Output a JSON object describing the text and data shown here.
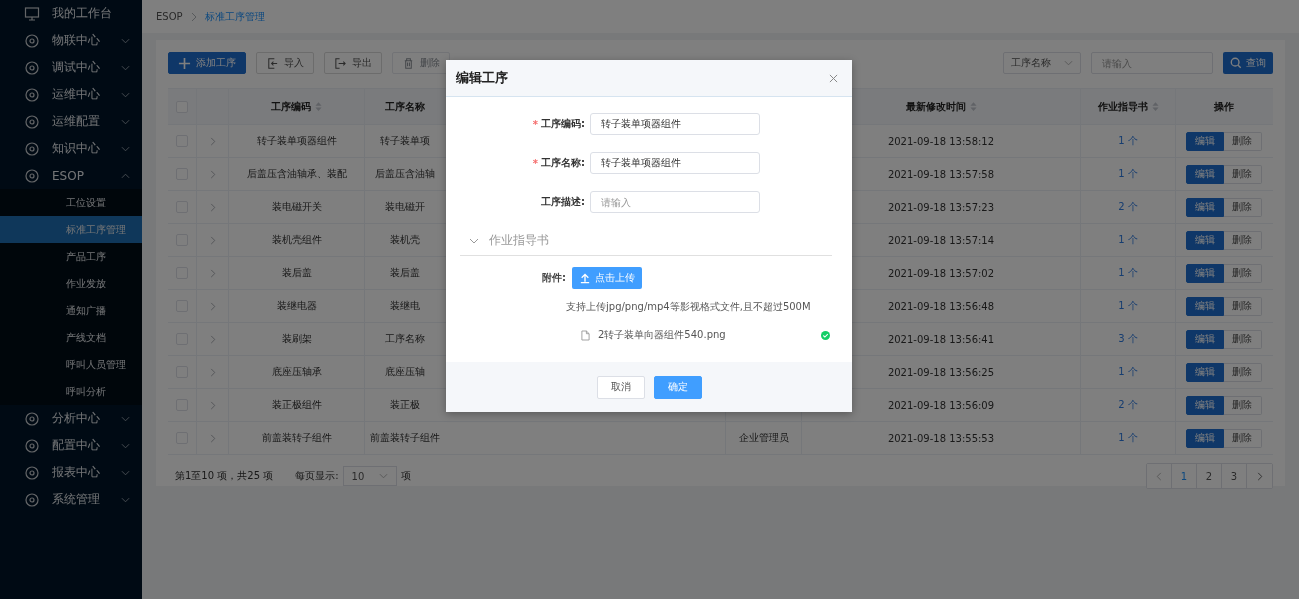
{
  "sidebar": {
    "items": [
      {
        "label": "我的工作台"
      },
      {
        "label": "物联中心",
        "expanded": false
      },
      {
        "label": "调试中心",
        "expanded": false
      },
      {
        "label": "运维中心",
        "expanded": false
      },
      {
        "label": "运维配置",
        "expanded": false
      },
      {
        "label": "知识中心",
        "expanded": false
      },
      {
        "label": "ESOP",
        "expanded": true,
        "children": [
          {
            "label": "工位设置",
            "selected": false
          },
          {
            "label": "标准工序管理",
            "selected": true
          },
          {
            "label": "产品工序",
            "selected": false
          },
          {
            "label": "作业发放",
            "selected": false
          },
          {
            "label": "通知广播",
            "selected": false
          },
          {
            "label": "产线文档",
            "selected": false
          },
          {
            "label": "呼叫人员管理",
            "selected": false
          },
          {
            "label": "呼叫分析",
            "selected": false
          }
        ]
      },
      {
        "label": "分析中心",
        "expanded": false
      },
      {
        "label": "配置中心",
        "expanded": false
      },
      {
        "label": "报表中心",
        "expanded": false
      },
      {
        "label": "系统管理",
        "expanded": false
      }
    ]
  },
  "breadcrumb": [
    "ESOP",
    "标准工序管理"
  ],
  "toolbar": {
    "buttons": [
      {
        "label": "添加工序",
        "kind": "primary",
        "disabled": false
      },
      {
        "label": "导入",
        "kind": "import",
        "disabled": false
      },
      {
        "label": "导出",
        "kind": "export",
        "disabled": false
      },
      {
        "label": "删除",
        "kind": "delete",
        "disabled": true
      }
    ],
    "filter_field": "工序名称",
    "search": {
      "placeholder": "请输入"
    },
    "search_button": "查询"
  },
  "table": {
    "all_checked": false,
    "columns": [
      {
        "label": "工序编码",
        "sortable": true
      },
      {
        "label": "工序名称",
        "sortable": false
      },
      {
        "label": "最新修改时间",
        "sortable": true
      },
      {
        "label": "作业指导书",
        "sortable": true
      },
      {
        "label": "操作",
        "sortable": false
      }
    ],
    "rows": [
      {
        "checked": false,
        "code": "转子装单项器组件",
        "name": "转子装单项",
        "modified": "2021-09-18 13:58:12",
        "guides": "1 个",
        "actions": [
          "编辑",
          "删除"
        ]
      },
      {
        "checked": false,
        "code": "后盖压含油轴承、装配",
        "name": "后盖压含油轴",
        "modified": "2021-09-18 13:57:58",
        "guides": "1 个",
        "actions": [
          "编辑",
          "删除"
        ]
      },
      {
        "checked": false,
        "code": "装电磁开关",
        "name": "装电磁开",
        "modified": "2021-09-18 13:57:23",
        "guides": "2 个",
        "actions": [
          "编辑",
          "删除"
        ]
      },
      {
        "checked": false,
        "code": "装机壳组件",
        "name": "装机壳",
        "modified": "2021-09-18 13:57:14",
        "guides": "1 个",
        "actions": [
          "编辑",
          "删除"
        ]
      },
      {
        "checked": false,
        "code": "装后盖",
        "name": "装后盖",
        "modified": "2021-09-18 13:57:02",
        "guides": "1 个",
        "actions": [
          "编辑",
          "删除"
        ]
      },
      {
        "checked": false,
        "code": "装继电器",
        "name": "装继电",
        "modified": "2021-09-18 13:56:48",
        "guides": "1 个",
        "actions": [
          "编辑",
          "删除"
        ]
      },
      {
        "checked": false,
        "code": "装刷架",
        "name": "工序名称",
        "modified": "2021-09-18 13:56:41",
        "guides": "3 个",
        "actions": [
          "编辑",
          "删除"
        ]
      },
      {
        "checked": false,
        "code": "底座压轴承",
        "name": "底座压轴",
        "modified": "2021-09-18 13:56:25",
        "guides": "1 个",
        "actions": [
          "编辑",
          "删除"
        ]
      },
      {
        "checked": false,
        "code": "装正极组件",
        "name": "装正极",
        "modified": "2021-09-18 13:56:09",
        "guides": "2 个",
        "actions": [
          "编辑",
          "删除"
        ]
      },
      {
        "checked": false,
        "code": "前盖装转子组件",
        "name": "前盖装转子组件",
        "column_4": "企业管理员",
        "modified": "2021-09-18 13:55:53",
        "guides": "1 个",
        "actions": [
          "编辑",
          "删除"
        ]
      }
    ]
  },
  "footer": {
    "summary": "第1至10 项，共25 项",
    "page_size_label": "每页显示:",
    "page_size": "10",
    "page_size_unit": "项",
    "pages": [
      {
        "label": "1",
        "selected": true
      },
      {
        "label": "2",
        "selected": false
      },
      {
        "label": "3",
        "selected": false
      }
    ]
  },
  "dialog": {
    "title": "编辑工序",
    "fields": [
      {
        "label": "工序编码:",
        "required_mark": "*",
        "value": "转子装单项器组件"
      },
      {
        "label": "工序名称:",
        "required_mark": "*",
        "value": "转子装单项器组件"
      },
      {
        "label": "工序描述:",
        "placeholder": "请输入"
      }
    ],
    "section": {
      "title": "作业指导书",
      "expanded": true
    },
    "attachment_label": "附件:",
    "upload_button": "点击上传",
    "hint": "支持上传jpg/png/mp4等影视格式文件,且不超过500M",
    "files": [
      {
        "name": "2转子装单向器组件540.png",
        "uploaded": true
      }
    ],
    "buttons": [
      {
        "label": "取消",
        "kind": "default"
      },
      {
        "label": "确定",
        "kind": "primary"
      }
    ]
  }
}
